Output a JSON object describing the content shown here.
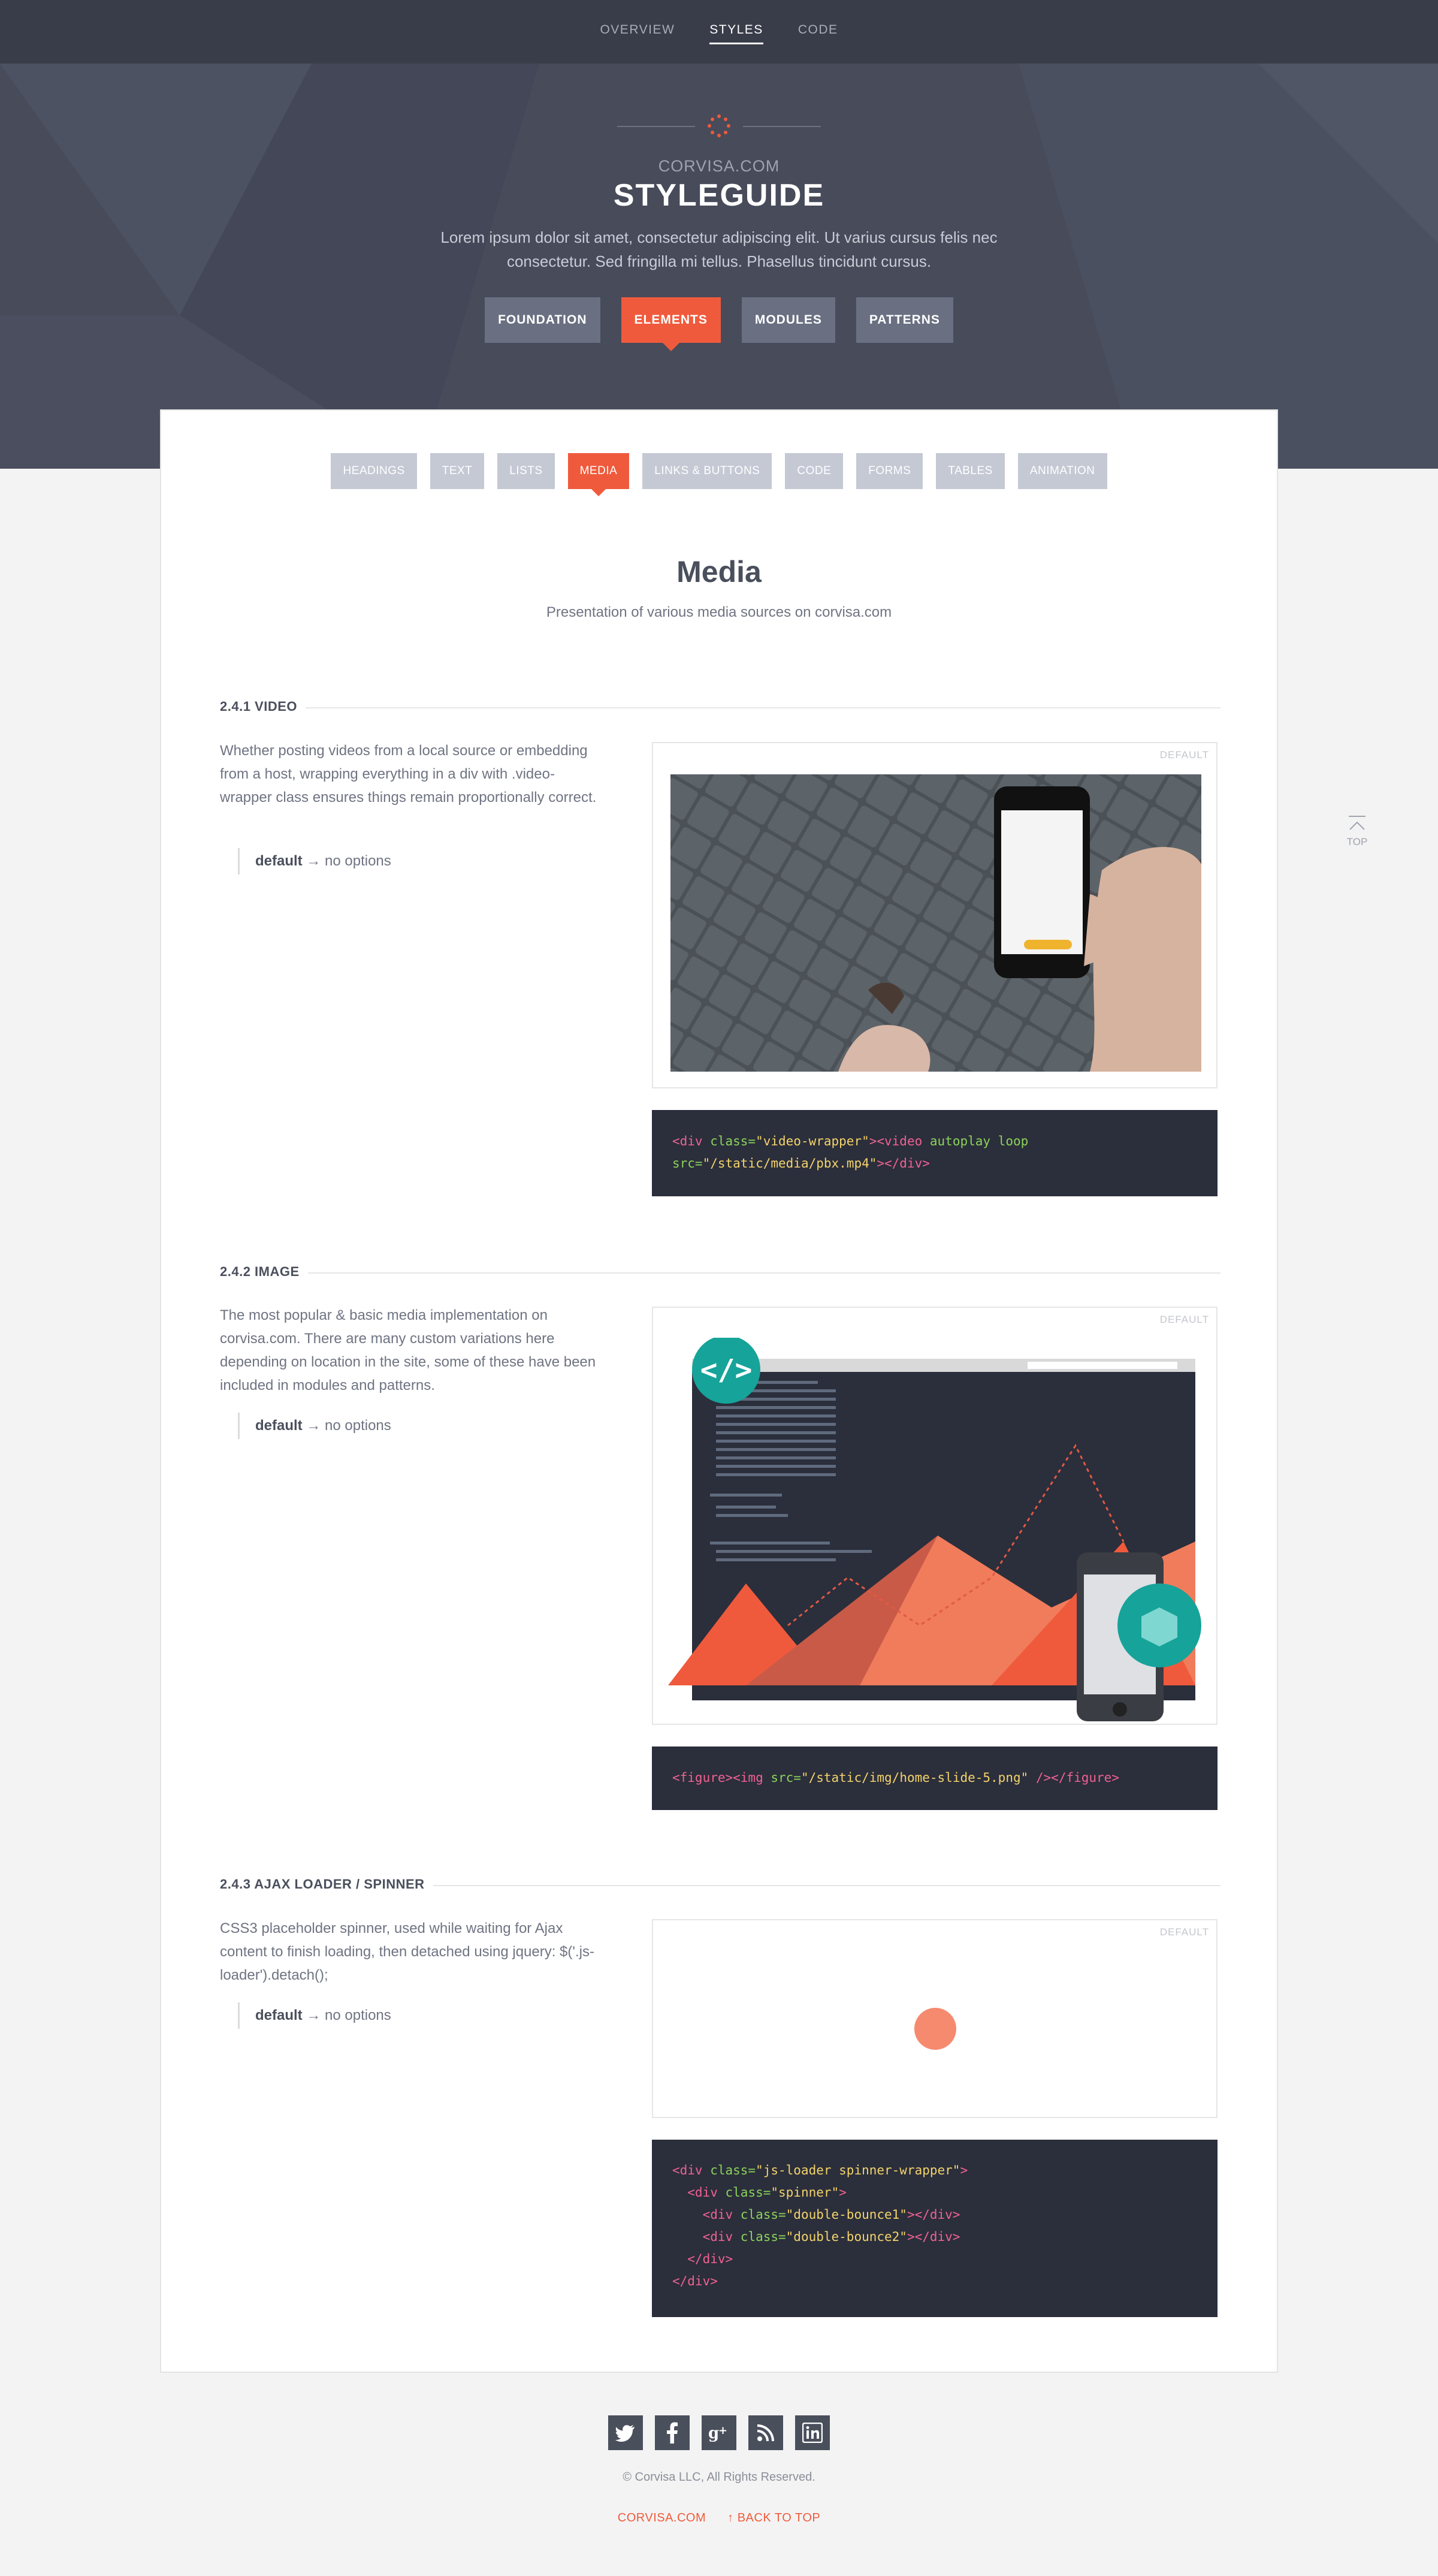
{
  "topnav": {
    "items": [
      "OVERVIEW",
      "STYLES",
      "CODE"
    ],
    "active": "STYLES"
  },
  "hero": {
    "subtitle": "CORVISA.COM",
    "title": "STYLEGUIDE",
    "description": "Lorem ipsum dolor sit amet, consectetur adipiscing elit. Ut varius cursus felis nec consectetur. Sed fringilla mi tellus. Phasellus tincidunt cursus.",
    "buttons": [
      "FOUNDATION",
      "ELEMENTS",
      "MODULES",
      "PATTERNS"
    ],
    "active_button": "ELEMENTS"
  },
  "subnav": {
    "items": [
      "HEADINGS",
      "TEXT",
      "LISTS",
      "MEDIA",
      "LINKS & BUTTONS",
      "CODE",
      "FORMS",
      "TABLES",
      "ANIMATION"
    ],
    "active": "MEDIA"
  },
  "section": {
    "title": "Media",
    "subtitle": "Presentation of various media sources on corvisa.com"
  },
  "blocks": {
    "video": {
      "heading": "2.4.1 VIDEO",
      "text": "Whether posting videos from a local source or embedding from a host, wrapping everything in a div with .video-wrapper class ensures things remain proportionally correct.",
      "option_name": "default",
      "option_desc": " → no options",
      "tag": "DEFAULT"
    },
    "image": {
      "heading": "2.4.2 IMAGE",
      "text": "The most popular & basic media implementation on corvisa.com. There are many custom variations here depending on location in the site, some of these have been included in modules and patterns.",
      "option_name": "default",
      "option_desc": " → no options",
      "tag": "DEFAULT"
    },
    "spinner": {
      "heading": "2.4.3 AJAX LOADER / SPINNER",
      "text": "CSS3 placeholder spinner, used while waiting for Ajax content to finish loading, then detached using jquery: $('.js-loader').detach();",
      "option_name": "default",
      "option_desc": " → no options",
      "tag": "DEFAULT"
    }
  },
  "code": {
    "video_l1_open": "<div ",
    "video_l1_attr1": "class=",
    "video_l1_val1": "\"video-wrapper\"",
    "video_l1_mid": "><video ",
    "video_l1_attr2": "autoplay loop",
    "video_l2_attr": "src=",
    "video_l2_val": "\"/static/media/pbx.mp4\"",
    "video_l2_close": "></div>",
    "image_open": "<figure><img ",
    "image_attr": "src=",
    "image_val": "\"/static/img/home-slide-5.png\"",
    "image_close": " /></figure>",
    "spin_l1_tag": "<div ",
    "spin_l1_attr": "class=",
    "spin_l1_val": "\"js-loader spinner-wrapper\"",
    "spin_l1_end": ">",
    "spin_l2_tag": "  <div ",
    "spin_l2_attr": "class=",
    "spin_l2_val": "\"spinner\"",
    "spin_l2_end": ">",
    "spin_l3_tag": "    <div ",
    "spin_l3_attr": "class=",
    "spin_l3_val": "\"double-bounce1\"",
    "spin_l3_end": "></div>",
    "spin_l4_tag": "    <div ",
    "spin_l4_attr": "class=",
    "spin_l4_val": "\"double-bounce2\"",
    "spin_l4_end": "></div>",
    "spin_l5": "  </div>",
    "spin_l6": "</div>"
  },
  "to_top": "TOP",
  "footer": {
    "social": [
      "twitter-icon",
      "facebook-icon",
      "google-plus-icon",
      "rss-icon",
      "linkedin-icon"
    ],
    "copyright": "© Corvisa LLC, All Rights Reserved.",
    "links": [
      "CORVISA.COM",
      "↑ BACK TO TOP"
    ]
  },
  "colors": {
    "accent": "#f05a3c",
    "dark": "#393d49",
    "teal": "#16a39a"
  }
}
